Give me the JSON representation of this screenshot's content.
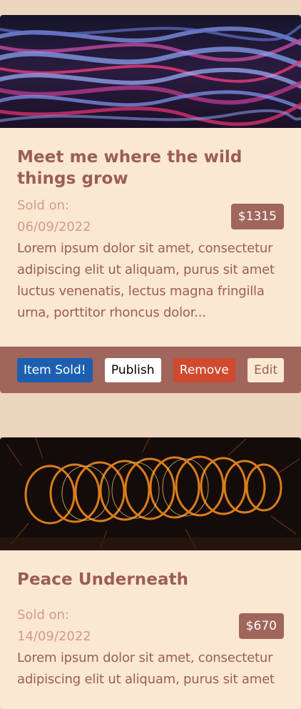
{
  "cards": [
    {
      "title": "Meet me where the wild things grow",
      "sold_label": "Sold on:",
      "sold_date": "06/09/2022",
      "price": "$1315",
      "description": "Lorem ipsum dolor sit amet, consectetur adipiscing elit ut aliquam, purus sit amet luctus venenatis, lectus magna fringilla urna, porttitor rhoncus dolor...",
      "actions": {
        "sold": "Item Sold!",
        "publish": "Publish",
        "remove": "Remove",
        "edit": "Edit"
      }
    },
    {
      "title": "Peace Underneath",
      "sold_label": "Sold on:",
      "sold_date": "14/09/2022",
      "price": "$670",
      "description": "Lorem ipsum dolor sit amet, consectetur adipiscing elit ut aliquam, purus sit amet"
    }
  ],
  "colors": {
    "page_background": "#ecd6c0",
    "card_background": "#fbe8d2",
    "accent": "#a0655b",
    "sold_button": "#1c5fb0",
    "remove_button": "#cf4a2e"
  }
}
